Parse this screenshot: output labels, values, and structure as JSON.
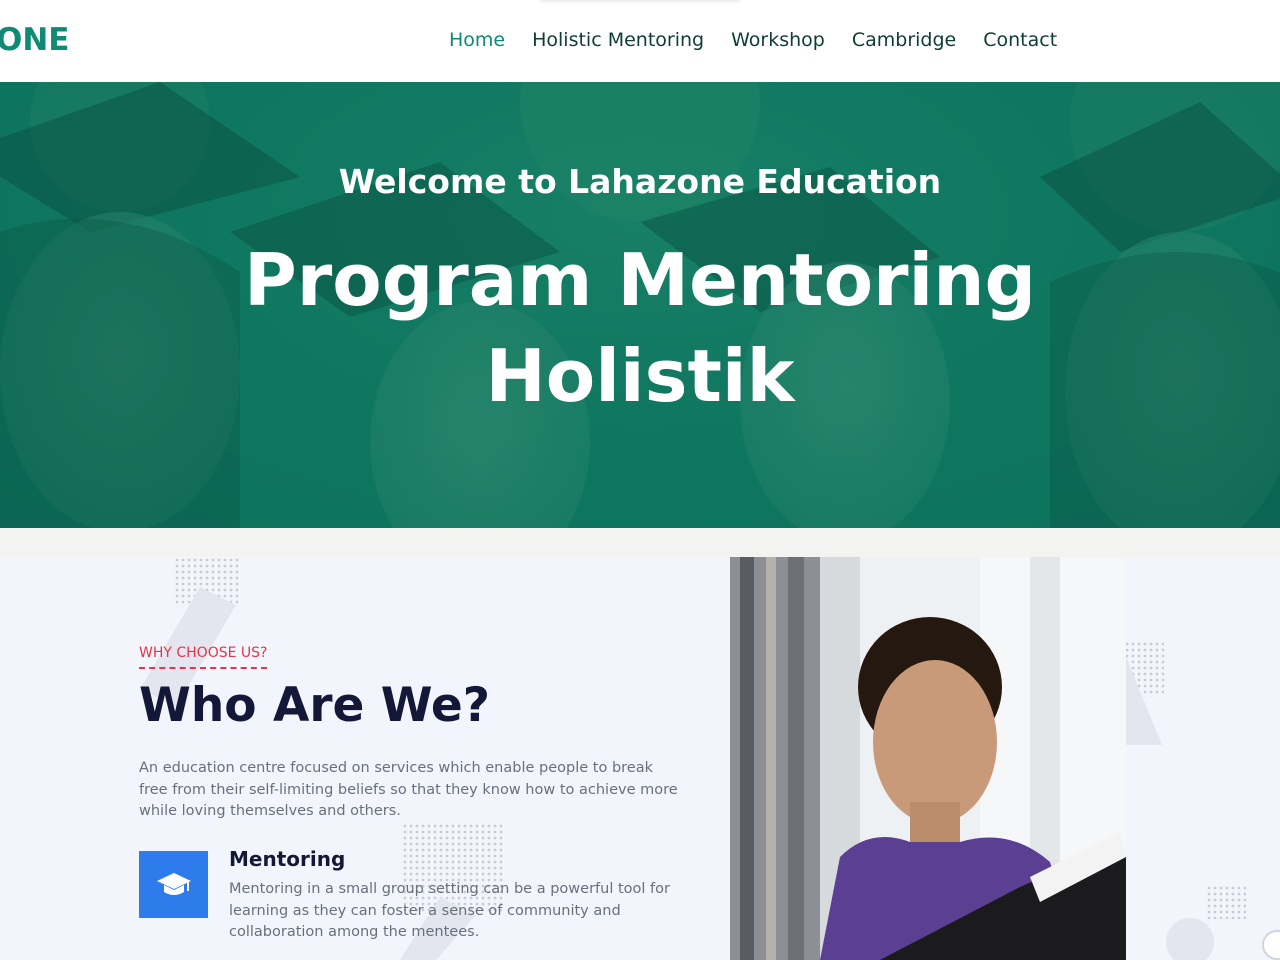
{
  "header": {
    "logo_text": "ONE",
    "nav": [
      {
        "label": "Home",
        "active": true
      },
      {
        "label": "Holistic Mentoring",
        "active": false
      },
      {
        "label": "Workshop",
        "active": false
      },
      {
        "label": "Cambridge",
        "active": false
      },
      {
        "label": "Contact",
        "active": false
      }
    ]
  },
  "hero": {
    "subtitle": "Welcome to Lahazone Education",
    "title_line1": "Program Mentoring",
    "title_line2": "Holistik",
    "overlay_color": "#0f7a62"
  },
  "about": {
    "eyebrow": "WHY CHOOSE US?",
    "title": "Who Are We?",
    "description": "An education centre focused on services which enable people to break free from their self-limiting beliefs so that they know how to achieve more while loving themselves and others.",
    "feature": {
      "icon": "graduation-cap-icon",
      "title": "Mentoring",
      "text": "Mentoring in a small group setting can be a powerful tool for learning as they can foster a sense of community and collaboration among the mentees."
    }
  },
  "colors": {
    "brand": "#0f8a74",
    "eyebrow": "#e8344a",
    "icon_bg": "#2e7bec",
    "heading": "#141838"
  }
}
